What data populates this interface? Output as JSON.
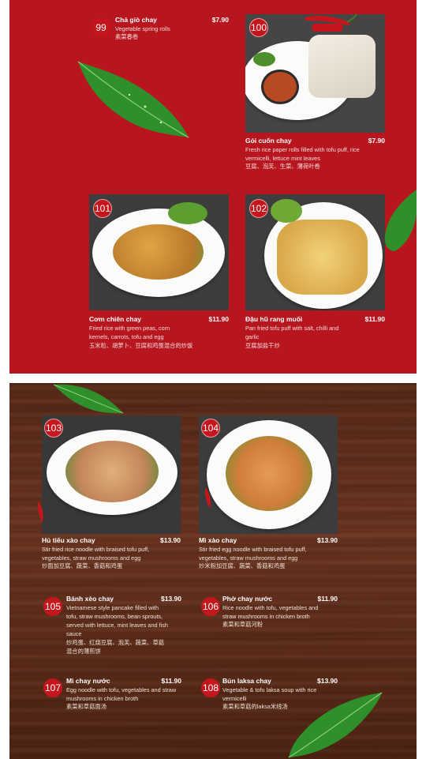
{
  "items": [
    {
      "number": "99",
      "name": "Chả giò chay",
      "price": "$7.90",
      "desc": "Vegetable spring rolls",
      "cn": "素菜春卷"
    },
    {
      "number": "100",
      "name": "Gỏi cuốn chay",
      "price": "$7.90",
      "desc": "Fresh rice paper rolls filled with tofu puff, rice vermicelli, lettuce mint leaves",
      "cn": "豆腐、泡芙、生菜、薄荷叶卷"
    },
    {
      "number": "101",
      "name": "Cơm chiên chay",
      "price": "$11.90",
      "desc": "Fried rice with green peas, corn kernels, carrots, tofu and egg",
      "cn": "玉米粒、胡萝卜、豆腐和鸡蛋混合的炒饭"
    },
    {
      "number": "102",
      "name": "Đậu hũ rang muối",
      "price": "$11.90",
      "desc": "Pan fried tofu puff with salt, chilli and garlic",
      "cn": "豆腐加盐干炒"
    },
    {
      "number": "103",
      "name": "Hủ tiếu xào chay",
      "price": "$13.90",
      "desc": "Stir fried rice noodle with braised tofu puff, vegetables, straw mushrooms and egg",
      "cn": "炒面加豆腐、蔬菜、香菇和鸡蛋"
    },
    {
      "number": "104",
      "name": "Mì xào chay",
      "price": "$13.90",
      "desc": "Stir fried egg noodle with braised tofu puff, vegetables, straw mushrooms and egg",
      "cn": "炒米粉加豆腐、蔬菜、香菇和鸡蛋"
    },
    {
      "number": "105",
      "name": "Bánh xèo chay",
      "price": "$13.90",
      "desc": "Vietnamese style pancake filled with tofu, straw mushrooms, bean sprouts, served with lettuce, mint leaves and fish sauce",
      "cn": "炒鸡蛋、红烧豆腐、泡芙、蔬菜、草菇混合的薄煎饼"
    },
    {
      "number": "106",
      "name": "Phở chay nước",
      "price": "$11.90",
      "desc": "Rice noodle with tofu, vegetables and straw mushrooms in chicken broth",
      "cn": "素菜和草菇河粉"
    },
    {
      "number": "107",
      "name": "Mì chay nước",
      "price": "$11.90",
      "desc": "Egg noodle with tofu, vegetables and straw mushrooms in chicken broth",
      "cn": "素菜和草菇面汤"
    },
    {
      "number": "108",
      "name": "Bún laksa chay",
      "price": "$13.90",
      "desc": "Vegetable & tofu laksa soup with rice vermicelli",
      "cn": "素菜和草菇的laksa米线汤"
    }
  ],
  "colors": {
    "red_page": "#b8161f",
    "badge": "#c4161c",
    "wood": "#5e2c19"
  }
}
